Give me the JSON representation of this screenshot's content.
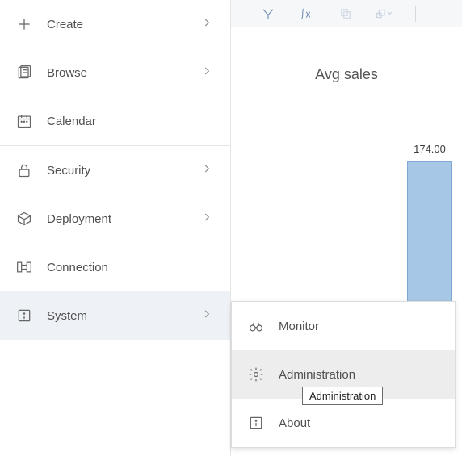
{
  "sidebar": {
    "items": [
      {
        "label": "Create",
        "has_chevron": true
      },
      {
        "label": "Browse",
        "has_chevron": true
      },
      {
        "label": "Calendar",
        "has_chevron": false
      },
      {
        "label": "Security",
        "has_chevron": true
      },
      {
        "label": "Deployment",
        "has_chevron": true
      },
      {
        "label": "Connection",
        "has_chevron": false
      },
      {
        "label": "System",
        "has_chevron": true,
        "active": true
      }
    ]
  },
  "submenu": {
    "items": [
      {
        "label": "Monitor"
      },
      {
        "label": "Administration",
        "hover": true
      },
      {
        "label": "About"
      }
    ]
  },
  "tooltip": {
    "text": "Administration"
  },
  "chart": {
    "title": "Avg sales",
    "bar_label": "174.00"
  },
  "chart_data": {
    "type": "bar",
    "title": "Avg sales",
    "categories": [
      ""
    ],
    "values": [
      174.0
    ],
    "ylabel": "",
    "xlabel": ""
  }
}
